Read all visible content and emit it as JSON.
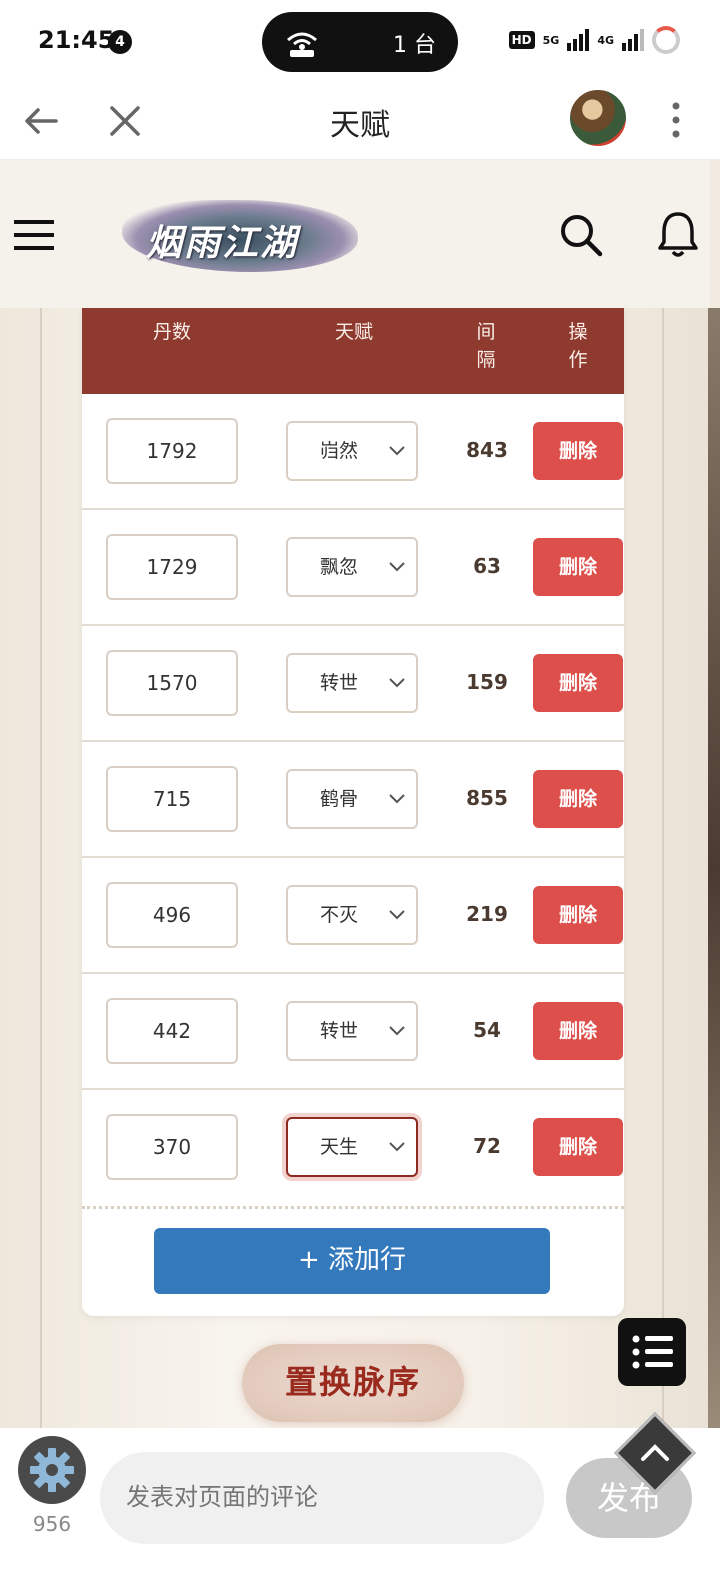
{
  "status_bar": {
    "time": "21:45",
    "notification_count": "4",
    "island_label": "1 台",
    "hd_label": "HD",
    "net_5g": "5G",
    "net_4g": "4G"
  },
  "header": {
    "title": "天赋"
  },
  "site": {
    "logo_text": "烟雨江湖"
  },
  "table": {
    "headers": {
      "dan": "丹数",
      "talent": "天赋",
      "gap": "间隔",
      "op": "操作"
    },
    "rows": [
      {
        "dan": "1792",
        "talent": "岿然",
        "gap": "843",
        "delete": "删除"
      },
      {
        "dan": "1729",
        "talent": "飘忽",
        "gap": "63",
        "delete": "删除"
      },
      {
        "dan": "1570",
        "talent": "转世",
        "gap": "159",
        "delete": "删除"
      },
      {
        "dan": "715",
        "talent": "鹤骨",
        "gap": "855",
        "delete": "删除"
      },
      {
        "dan": "496",
        "talent": "不灭",
        "gap": "219",
        "delete": "删除"
      },
      {
        "dan": "442",
        "talent": "转世",
        "gap": "54",
        "delete": "删除"
      },
      {
        "dan": "370",
        "talent": "天生",
        "gap": "72",
        "delete": "删除"
      }
    ],
    "add_row_label": "+ 添加行"
  },
  "swap_button_label": "置换脉序",
  "comment_bar": {
    "count": "956",
    "placeholder": "发表对页面的评论",
    "publish_label": "发布"
  },
  "colors": {
    "table_header": "#8e3a2e",
    "delete_button": "#dc4f4a",
    "add_button": "#3579bd",
    "swap_text": "#9a2a1e"
  }
}
